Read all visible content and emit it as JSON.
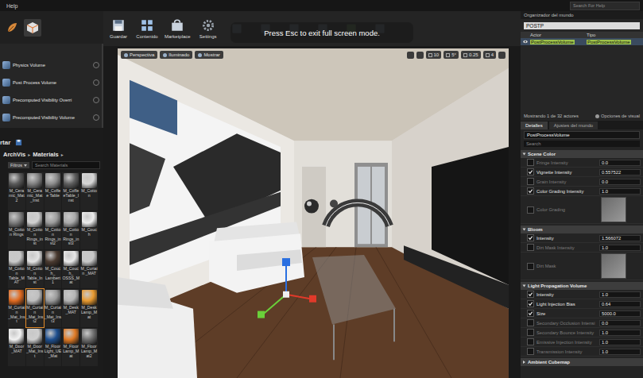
{
  "menubar": {
    "items": [
      "Help"
    ],
    "search_placeholder": "Search For Help"
  },
  "toolbar": {
    "buttons": [
      {
        "label": "Guardar"
      },
      {
        "label": "Contenido"
      },
      {
        "label": "Marketplace"
      },
      {
        "label": "Settings"
      }
    ]
  },
  "fullscreen_notice": "Press Esc to exit full screen mode.",
  "modes": {
    "items": [
      "Physics Volume",
      "Post Process Volume",
      "Precomputed Visibility Overri",
      "Precomputed Visibility Volume"
    ]
  },
  "content_browser": {
    "tab": "rtar",
    "path": [
      "ArchVis",
      "Materials"
    ],
    "path_separator": "▸",
    "filter": "Filtros",
    "search_placeholder": "Search Materials",
    "assets": [
      {
        "label": "M_Ceramic_Mat2",
        "color": "#5a5a5a",
        "selected": false
      },
      {
        "label": "M_Ceramic_Mat_Inst",
        "color": "#808080",
        "selected": false
      },
      {
        "label": "M_Coffee Table",
        "color": "#8c8c8c",
        "selected": false
      },
      {
        "label": "M_CoffeeTable_Inst",
        "color": "#5e5e5e",
        "selected": false
      },
      {
        "label": "M_Cotton",
        "color": "#d6d6d6",
        "selected": false
      },
      {
        "label": "M_Cotton Rings",
        "color": "#7d7d7d",
        "selected": false
      },
      {
        "label": "M_Cotton Rings_inst",
        "color": "#d0d0d0",
        "selected": false
      },
      {
        "label": "M_Cotton Rings_inst2",
        "color": "#9c9c9c",
        "selected": false
      },
      {
        "label": "M_Cotton Rings_inst3",
        "color": "#a9a9a9",
        "selected": false
      },
      {
        "label": "M_Couch",
        "color": "#ececec",
        "selected": false
      },
      {
        "label": "M_Cotton Table_MAT",
        "color": "#c9c9c9",
        "selected": false
      },
      {
        "label": "M_Cotton Table_Inst",
        "color": "#e2e2e2",
        "selected": false
      },
      {
        "label": "M_Couch_ Lambert1",
        "color": "#4a3a30",
        "selected": false
      },
      {
        "label": "M_Couch_ OSSS_Mat",
        "color": "#e8e8e8",
        "selected": false
      },
      {
        "label": "M_Curtain _MAT",
        "color": "#c8c8c8",
        "selected": false
      },
      {
        "label": "M_Curtain _Mat_Inst",
        "color": "#e06a20",
        "selected": false
      },
      {
        "label": "M_Curtain _Mat_Inst2",
        "color": "#bfbfbf",
        "selected": true
      },
      {
        "label": "M_Curtain _Mat_Inst3",
        "color": "#9a9a9a",
        "selected": false
      },
      {
        "label": "M_Desk _MAT",
        "color": "#b5b5b5",
        "selected": false
      },
      {
        "label": "M_Desk Lamp_Mat",
        "color": "#e89a30",
        "selected": false
      },
      {
        "label": "M_Door _MAT",
        "color": "#f2f2f2",
        "selected": false
      },
      {
        "label": "M_Door _Mat_Inst",
        "color": "#cfcfcf",
        "selected": false
      },
      {
        "label": "M_Floor Light_UE _Mat",
        "color": "#1e4f8f",
        "selected": false
      },
      {
        "label": "M_Floor Lamp_Mat",
        "color": "#e07a25",
        "selected": false
      },
      {
        "label": "M_Floor Lamp_Mat2",
        "color": "#6f6f6f",
        "selected": false
      }
    ]
  },
  "viewport": {
    "view_buttons": [
      "Perspectiva",
      "Iluminado",
      "Mostrar"
    ],
    "snap_values": [
      "10",
      "5°",
      "0.25",
      "4"
    ]
  },
  "outliner": {
    "title": "Organizador del mundo",
    "search": "POSTP",
    "columns": [
      "Actor",
      "Tipo"
    ],
    "rows": [
      {
        "actor": "PostProcessVolume",
        "type": "PostProcessVolume",
        "selected": true
      }
    ],
    "status": "Mostrando 1 de 32 actores",
    "view_options": "Opciones de visual"
  },
  "details": {
    "tabs": [
      {
        "label": "Detalles",
        "selected": true
      },
      {
        "label": "Ajustes del mundo",
        "selected": false
      }
    ],
    "object_name": "PostProcessVolume",
    "search_placeholder": "Search",
    "sections": [
      {
        "title": "Scene Color",
        "expanded": true,
        "rows": [
          {
            "label": "Fringe Intensity",
            "checked": false,
            "kind": "number",
            "value": "0.0"
          },
          {
            "label": "Vignette Intensity",
            "checked": true,
            "kind": "number",
            "value": "0.557522"
          },
          {
            "label": "Grain Intensity",
            "checked": false,
            "kind": "number",
            "value": "0.0"
          },
          {
            "label": "Color Grading Intensity",
            "checked": true,
            "kind": "number",
            "value": "1.0"
          },
          {
            "label": "Color Grading",
            "checked": false,
            "kind": "texture"
          }
        ]
      },
      {
        "title": "Bloom",
        "expanded": true,
        "rows": [
          {
            "label": "Intensity",
            "checked": true,
            "kind": "number",
            "value": "1.566072"
          },
          {
            "label": "Dirt Mask Intensity",
            "checked": false,
            "kind": "number",
            "value": "1.0"
          },
          {
            "label": "Dirt Mask",
            "checked": false,
            "kind": "texture"
          }
        ]
      },
      {
        "title": "Light Propagation Volume",
        "expanded": true,
        "rows": [
          {
            "label": "Intensity",
            "checked": true,
            "kind": "number",
            "value": "1.0"
          },
          {
            "label": "Light Injection Bias",
            "checked": true,
            "kind": "number",
            "value": "0.64"
          },
          {
            "label": "Size",
            "checked": true,
            "kind": "number",
            "value": "5000.0"
          },
          {
            "label": "Secondary Occlusion Intensi",
            "checked": false,
            "kind": "number",
            "value": "0.0"
          },
          {
            "label": "Secondary Bounce Intensity",
            "checked": false,
            "kind": "number",
            "value": "1.0"
          },
          {
            "label": "Emissive Injection Intensity",
            "checked": false,
            "kind": "number",
            "value": "1.0"
          },
          {
            "label": "Transmission Intensity",
            "checked": false,
            "kind": "number",
            "value": "1.0"
          }
        ]
      },
      {
        "title": "Ambient Cubemap",
        "expanded": false,
        "rows": []
      }
    ]
  }
}
